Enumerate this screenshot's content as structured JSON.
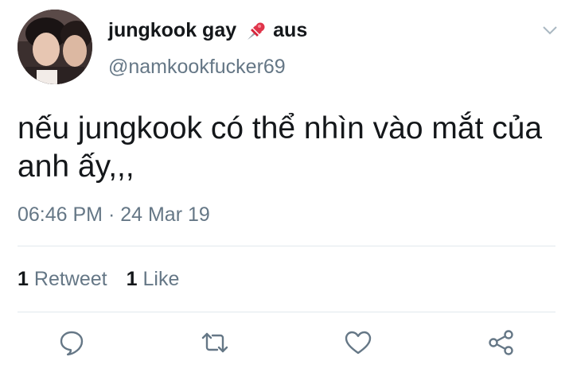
{
  "user": {
    "display_name_part1": "jungkook gay",
    "pin_icon": "pushpin-icon",
    "display_name_part2": "aus",
    "handle": "@namkookfucker69"
  },
  "tweet": {
    "text": "nếu jungkook có thể nhìn vào mắt của anh ấy,,,",
    "timestamp": "06:46 PM · 24 Mar 19"
  },
  "stats": {
    "retweet_count": "1",
    "retweet_label": "Retweet",
    "like_count": "1",
    "like_label": "Like"
  },
  "actions": [
    "reply-icon",
    "retweet-icon",
    "like-icon",
    "share-icon"
  ],
  "colors": {
    "text": "#14171a",
    "secondary": "#657786",
    "icon": "#657786",
    "divider": "#e1e8ed"
  }
}
